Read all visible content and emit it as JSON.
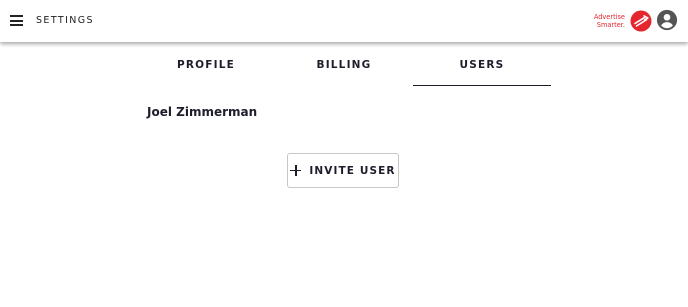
{
  "header": {
    "title": "SETTINGS",
    "menu_icon": "hamburger-menu-icon",
    "brand": {
      "line1": "Advertise",
      "line2": "Smarter.",
      "logo_icon": "brand-logo-icon",
      "color": "#e4262f"
    },
    "account_icon": "account-circle-icon"
  },
  "tabs": [
    {
      "label": "PROFILE",
      "active": false
    },
    {
      "label": "BILLING",
      "active": false
    },
    {
      "label": "USERS",
      "active": true
    }
  ],
  "users": [
    {
      "name": "Joel Zimmerman"
    }
  ],
  "invite_button": {
    "label": "INVITE USER",
    "icon": "plus-icon"
  },
  "colors": {
    "text": "#1f1d2b",
    "accent": "#e4262f",
    "icon_gray": "#555555"
  }
}
